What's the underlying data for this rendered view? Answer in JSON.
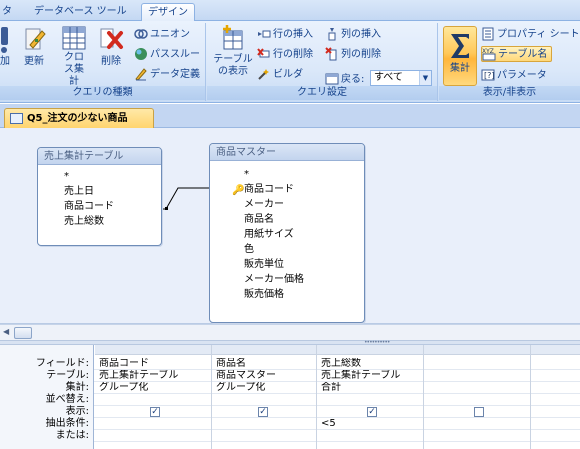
{
  "ribbon": {
    "tabs": [
      "タ",
      "データベース ツール",
      "デザイン"
    ],
    "groups": {
      "query_type": {
        "label": "クエリの種類",
        "buttons": [
          "加",
          "更新",
          "クロス集計",
          "削除"
        ],
        "small": [
          "ユニオン",
          "パススルー",
          "データ定義"
        ]
      },
      "query_setup": {
        "label": "クエリ設定",
        "show_table": "テーブルの表示",
        "small": [
          "行の挿入",
          "行の削除",
          "ビルダ",
          "列の挿入",
          "列の削除",
          "戻る:"
        ],
        "return_value": "すべて"
      },
      "show_hide": {
        "label": "表示/非表示",
        "totals": "集計",
        "small": [
          "プロパティ シート",
          "テーブル名",
          "パラメータ"
        ]
      }
    }
  },
  "document": {
    "tab_title": "Q5_注文の少ない商品",
    "tables": [
      {
        "title": "売上集計テーブル",
        "fields": [
          "*",
          "売上日",
          "商品コード",
          "売上総数"
        ]
      },
      {
        "title": "商品マスター",
        "fields": [
          "*",
          "商品コード",
          "メーカー",
          "商品名",
          "用紙サイズ",
          "色",
          "販売単位",
          "メーカー価格",
          "販売価格"
        ]
      }
    ]
  },
  "grid": {
    "row_labels": [
      "フィールド:",
      "テーブル:",
      "集計:",
      "並べ替え:",
      "表示:",
      "抽出条件:",
      "または:"
    ],
    "columns": [
      {
        "field": "商品コード",
        "table": "売上集計テーブル",
        "total": "グループ化",
        "sort": "",
        "show": true,
        "criteria": "",
        "or": ""
      },
      {
        "field": "商品名",
        "table": "商品マスター",
        "total": "グループ化",
        "sort": "",
        "show": true,
        "criteria": "",
        "or": ""
      },
      {
        "field": "売上総数",
        "table": "売上集計テーブル",
        "total": "合計",
        "sort": "",
        "show": true,
        "criteria": "<5",
        "or": ""
      },
      {
        "field": "",
        "table": "",
        "total": "",
        "sort": "",
        "show": false,
        "criteria": "",
        "or": ""
      }
    ]
  },
  "colors": {
    "accent": "#15428b",
    "ribbon_bg": "#dbe8f9",
    "selected": "#ffc85a"
  }
}
